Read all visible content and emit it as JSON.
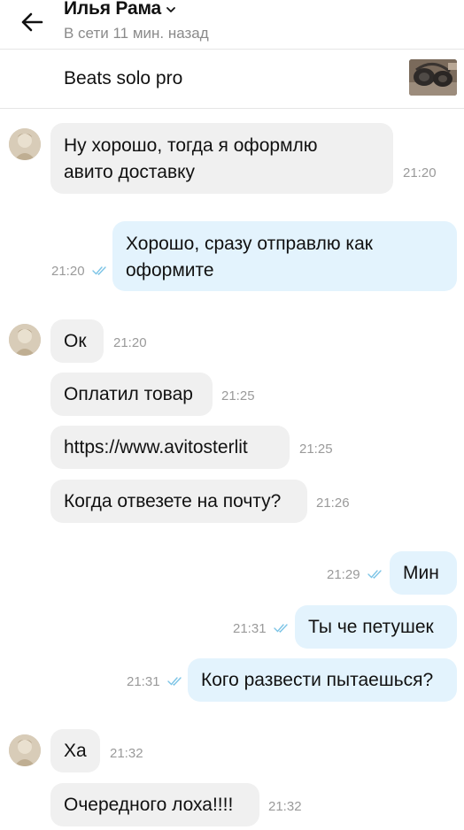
{
  "header": {
    "name": "Илья Рама",
    "status": "В сети 11 мин. назад"
  },
  "item": {
    "title": "Beats solo pro"
  },
  "messages": [
    {
      "dir": "in",
      "lines": [
        "Ну хорошо, тогда я оформлю",
        "авито доставку"
      ],
      "time": "21:20"
    },
    {
      "dir": "out",
      "lines": [
        "Хорошо,  сразу отправлю как",
        "оформите"
      ],
      "time": "21:20"
    },
    {
      "dir": "in",
      "lines": [
        "Ок"
      ],
      "time": "21:20"
    },
    {
      "dir": "in",
      "lines": [
        "Оплатил товар"
      ],
      "time": "21:25"
    },
    {
      "dir": "in",
      "lines": [
        "https://www.avitosterlit"
      ],
      "time": "21:25"
    },
    {
      "dir": "in",
      "lines": [
        "Когда отвезете на почту?"
      ],
      "time": "21:26"
    },
    {
      "dir": "out",
      "lines": [
        "Мин"
      ],
      "time": "21:29"
    },
    {
      "dir": "out",
      "lines": [
        "Ты че петушек"
      ],
      "time": "21:31"
    },
    {
      "dir": "out",
      "lines": [
        "Кого развести пытаешься?"
      ],
      "time": "21:31"
    },
    {
      "dir": "in",
      "lines": [
        "Ха"
      ],
      "time": "21:32"
    },
    {
      "dir": "in",
      "lines": [
        "Очередного лоха!!!!"
      ],
      "time": "21:32"
    }
  ],
  "colors": {
    "incoming_bubble": "#f0f0f0",
    "outgoing_bubble": "#e3f3fd",
    "read_ticks": "#7cc4e6",
    "muted_text": "#8a8a8a"
  },
  "icons": {
    "back": "arrow-left-icon",
    "chevron": "chevron-down-icon",
    "read": "double-check-icon"
  }
}
